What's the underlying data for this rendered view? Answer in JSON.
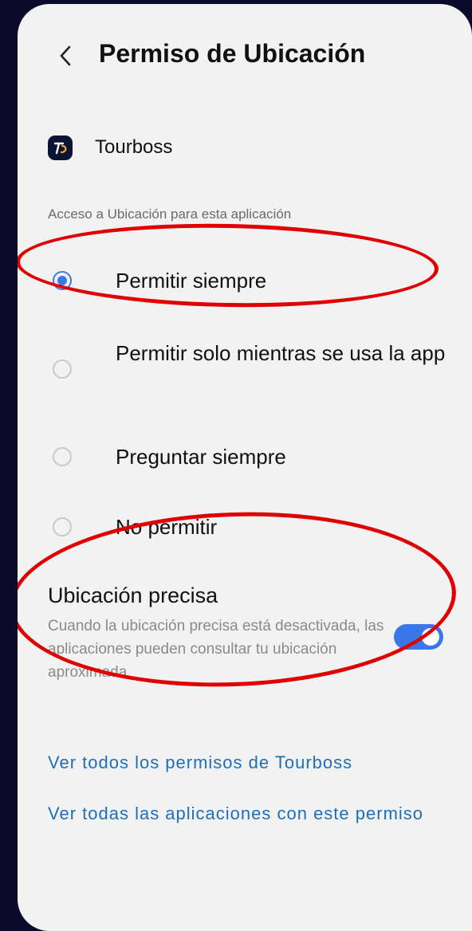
{
  "header": {
    "title": "Permiso de Ubicación",
    "back_icon": "chevron-left-icon"
  },
  "app": {
    "name": "Tourboss",
    "icon": "tourboss-app-icon",
    "icon_color": "#0b1433"
  },
  "section": {
    "label": "Acceso a Ubicación para esta aplicación"
  },
  "options": [
    {
      "label": "Permitir siempre",
      "checked": true
    },
    {
      "label": "Permitir solo mientras se usa la app",
      "checked": false
    },
    {
      "label": "Preguntar siempre",
      "checked": false
    },
    {
      "label": "No permitir",
      "checked": false
    }
  ],
  "precise": {
    "title": "Ubicación precisa",
    "description": "Cuando la ubicación precisa está desactivada, las aplicaciones pueden consultar tu ubicación aproximada",
    "enabled": true
  },
  "links": {
    "all_permissions": "Ver todos los permisos de Tourboss",
    "all_apps": "Ver todas las aplicaciones con este permiso"
  },
  "colors": {
    "accent": "#3a78e8",
    "link": "#1f6fb8",
    "annotation": "#e00000",
    "background": "#f2f2f2",
    "frame": "#0b0a2a"
  }
}
